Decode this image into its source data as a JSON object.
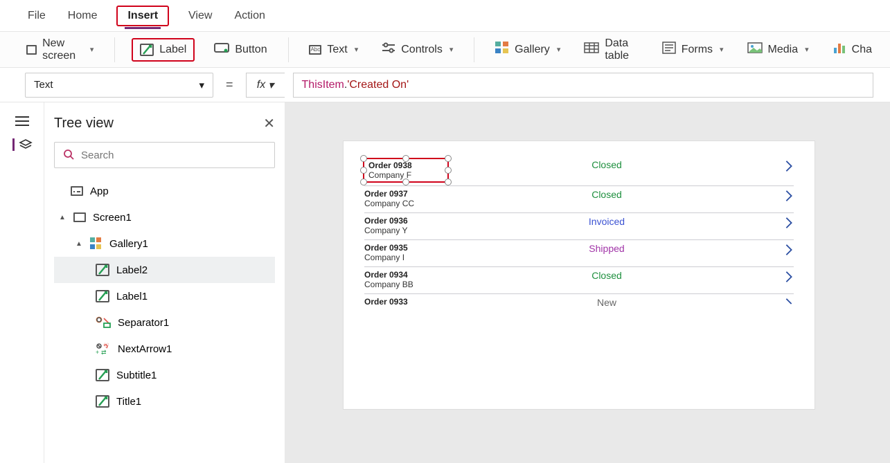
{
  "menu": {
    "tabs": [
      "File",
      "Home",
      "Insert",
      "View",
      "Action"
    ],
    "active": "Insert"
  },
  "ribbon": {
    "new_screen": "New screen",
    "label": "Label",
    "button": "Button",
    "text": "Text",
    "controls": "Controls",
    "gallery": "Gallery",
    "data_table": "Data table",
    "forms": "Forms",
    "media": "Media",
    "charts": "Cha"
  },
  "property_dropdown": "Text",
  "formula_parts": {
    "this": "ThisItem",
    "dot": ".",
    "prop": "'Created On'"
  },
  "tree_panel": {
    "title": "Tree view",
    "search_placeholder": "Search"
  },
  "tree": {
    "app": "App",
    "screen1": "Screen1",
    "gallery1": "Gallery1",
    "nodes": [
      {
        "label": "Label2",
        "selected": true,
        "icon": "label"
      },
      {
        "label": "Label1",
        "selected": false,
        "icon": "label"
      },
      {
        "label": "Separator1",
        "selected": false,
        "icon": "sep"
      },
      {
        "label": "NextArrow1",
        "selected": false,
        "icon": "nextarrow"
      },
      {
        "label": "Subtitle1",
        "selected": false,
        "icon": "label"
      },
      {
        "label": "Title1",
        "selected": false,
        "icon": "label"
      }
    ]
  },
  "gallery_rows": [
    {
      "title": "Order 0938",
      "subtitle": "Company F",
      "status": "Closed",
      "status_kind": "closed",
      "selected": true
    },
    {
      "title": "Order 0937",
      "subtitle": "Company CC",
      "status": "Closed",
      "status_kind": "closed",
      "selected": false
    },
    {
      "title": "Order 0936",
      "subtitle": "Company Y",
      "status": "Invoiced",
      "status_kind": "invoiced",
      "selected": false
    },
    {
      "title": "Order 0935",
      "subtitle": "Company I",
      "status": "Shipped",
      "status_kind": "shipped",
      "selected": false
    },
    {
      "title": "Order 0934",
      "subtitle": "Company BB",
      "status": "Closed",
      "status_kind": "closed",
      "selected": false
    },
    {
      "title": "Order 0933",
      "subtitle": "",
      "status": "New",
      "status_kind": "new",
      "selected": false
    }
  ]
}
